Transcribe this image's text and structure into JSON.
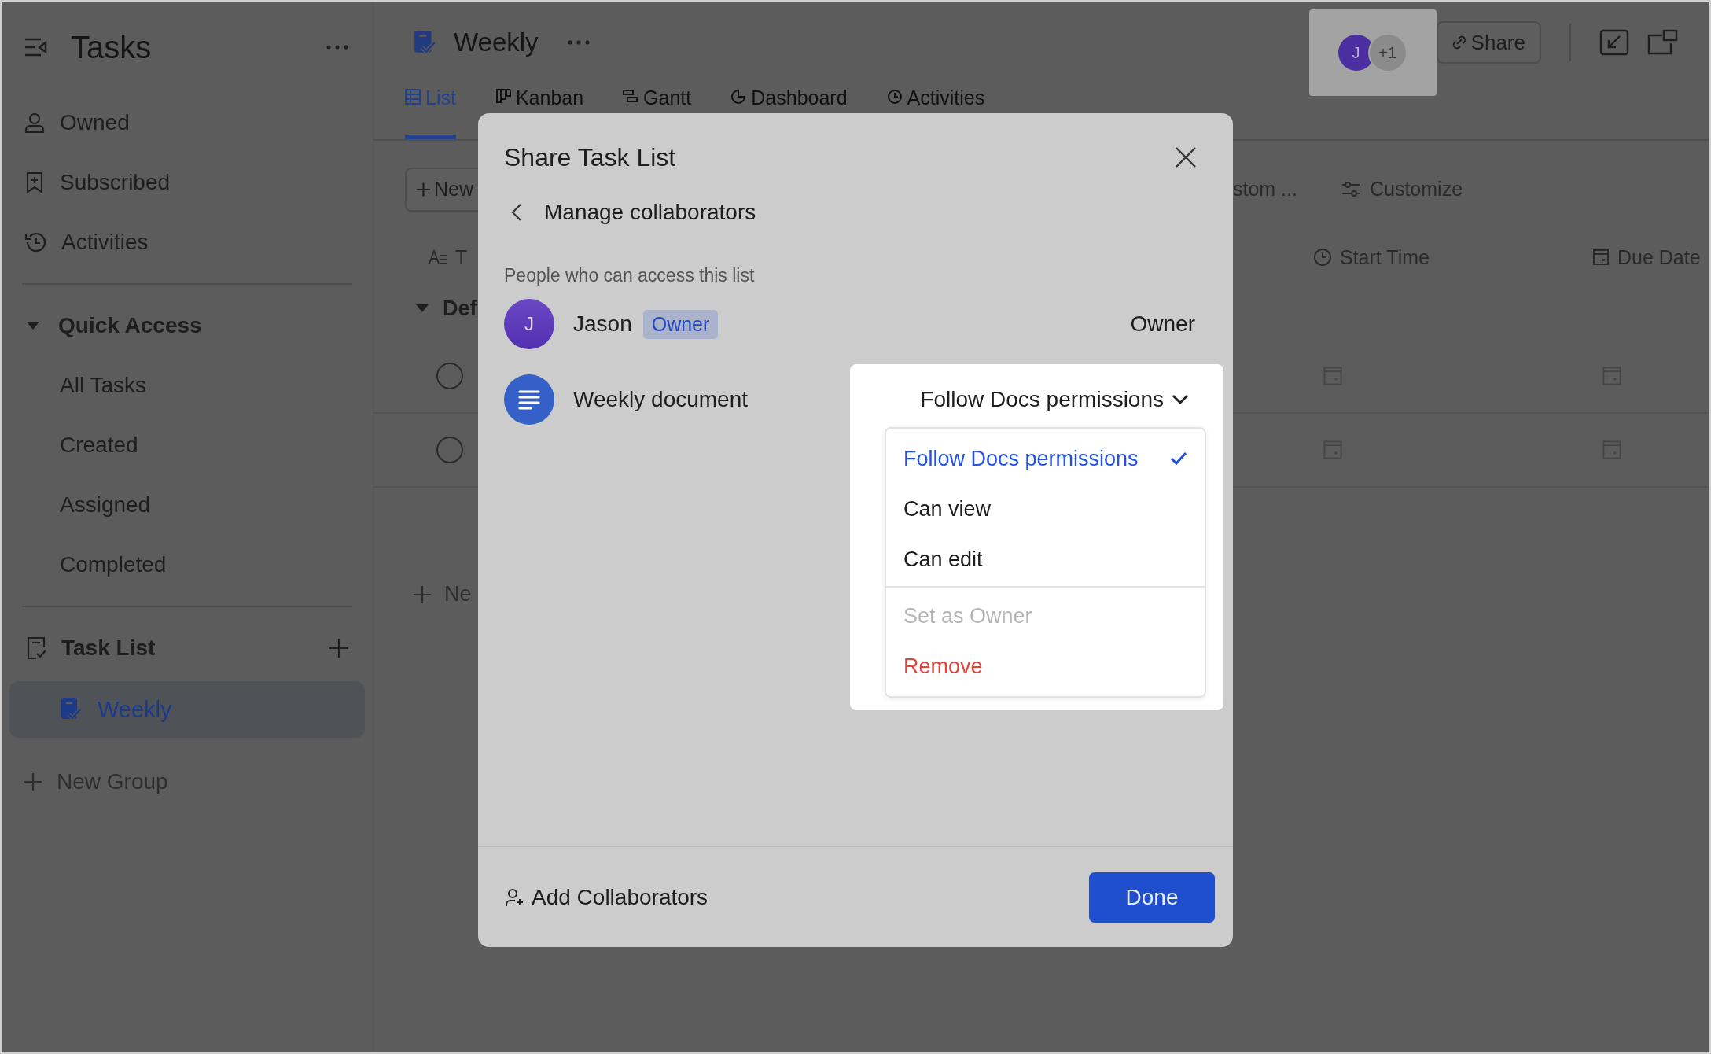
{
  "sidebar": {
    "title": "Tasks",
    "items": [
      {
        "label": "Owned",
        "selected": false
      },
      {
        "label": "Subscribed",
        "selected": false
      },
      {
        "label": "Activities",
        "selected": false
      }
    ],
    "quick_access": {
      "label": "Quick Access",
      "expanded": true,
      "items": [
        {
          "label": "All Tasks",
          "selected": false
        },
        {
          "label": "Created",
          "selected": false
        },
        {
          "label": "Assigned",
          "selected": false
        },
        {
          "label": "Completed",
          "selected": false
        }
      ]
    },
    "task_list": {
      "label": "Task List",
      "items": [
        {
          "label": "Weekly",
          "selected": true
        }
      ]
    },
    "new_group": "New Group"
  },
  "header": {
    "title": "Weekly",
    "avatars": [
      {
        "kind": "user",
        "text": "J"
      },
      {
        "kind": "more",
        "text": "+1"
      }
    ],
    "share_button": "Share"
  },
  "tabs": [
    {
      "label": "List",
      "selected": true
    },
    {
      "label": "Kanban",
      "selected": false
    },
    {
      "label": "Gantt",
      "selected": false
    },
    {
      "label": "Dashboard",
      "selected": false
    },
    {
      "label": "Activities",
      "selected": false
    }
  ],
  "toolbar": {
    "new_button": "New",
    "view_button": "stom ...",
    "customize_button": "Customize"
  },
  "table": {
    "columns": [
      {
        "label": "T"
      },
      {
        "label": "Start Time"
      },
      {
        "label": "Due Date"
      }
    ],
    "group": {
      "label": "Def",
      "expanded": true
    },
    "rows": [
      {
        "checked": false
      },
      {
        "checked": false
      }
    ],
    "new_task": "Ne"
  },
  "dialog": {
    "title": "Share Task List",
    "subtitle": "Manage collaborators",
    "section_label": "People who can access this list",
    "collaborators": [
      {
        "kind": "user",
        "initial": "J",
        "name": "Jason",
        "badge": "Owner",
        "role": "Owner",
        "open": false
      },
      {
        "kind": "document",
        "name": "Weekly document",
        "role": "Follow Docs permissions",
        "open": true
      }
    ],
    "menu_groups": [
      [
        {
          "label": "Follow Docs permissions",
          "selected": true,
          "disabled": false,
          "kind": "option"
        },
        {
          "label": "Can view",
          "selected": false,
          "disabled": false,
          "kind": "option"
        },
        {
          "label": "Can edit",
          "selected": false,
          "disabled": false,
          "kind": "option"
        }
      ],
      [
        {
          "label": "Set as Owner",
          "selected": false,
          "disabled": true,
          "kind": "option"
        },
        {
          "label": "Remove",
          "selected": false,
          "disabled": false,
          "kind": "danger"
        }
      ]
    ],
    "add_button": "Add Collaborators",
    "done_button": "Done"
  }
}
